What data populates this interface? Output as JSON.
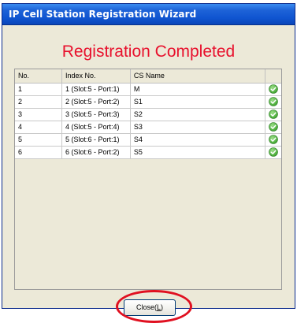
{
  "window": {
    "title": "IP Cell Station Registration Wizard"
  },
  "heading": "Registration Completed",
  "table": {
    "columns": [
      "No.",
      "Index No.",
      "CS Name",
      ""
    ],
    "rows": [
      {
        "no": "1",
        "index": "1 (Slot:5 - Port:1)",
        "name": "M",
        "status": "check-icon"
      },
      {
        "no": "2",
        "index": "2 (Slot:5 - Port:2)",
        "name": "S1",
        "status": "check-icon"
      },
      {
        "no": "3",
        "index": "3 (Slot:5 - Port:3)",
        "name": "S2",
        "status": "check-icon"
      },
      {
        "no": "4",
        "index": "4 (Slot:5 - Port:4)",
        "name": "S3",
        "status": "check-icon"
      },
      {
        "no": "5",
        "index": "5 (Slot:6 - Port:1)",
        "name": "S4",
        "status": "check-icon"
      },
      {
        "no": "6",
        "index": "6 (Slot:6 - Port:2)",
        "name": "S5",
        "status": "check-icon"
      }
    ]
  },
  "buttons": {
    "close_label": "Close(",
    "close_mnemonic": "L",
    "close_suffix": ")"
  },
  "colors": {
    "heading": "#e8112d",
    "highlight": "#e01020",
    "title_bar": "#0f54d0",
    "check_green": "#3fa52f"
  }
}
